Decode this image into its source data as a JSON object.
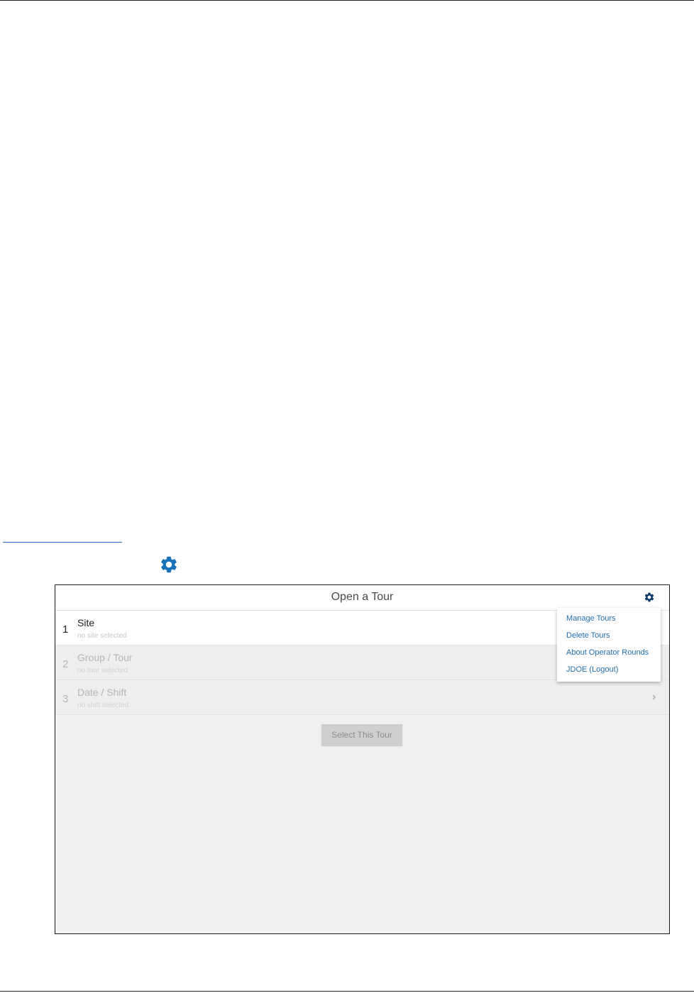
{
  "dialog": {
    "title": "Open a Tour",
    "steps": [
      {
        "number": "1",
        "title": "Site",
        "subtitle": "no site selected"
      },
      {
        "number": "2",
        "title": "Group / Tour",
        "subtitle": "no tour selected"
      },
      {
        "number": "3",
        "title": "Date / Shift",
        "subtitle": "no shift selected"
      }
    ],
    "chevron": "›",
    "select_button": "Select This Tour"
  },
  "menu": {
    "items": [
      "Manage Tours",
      "Delete Tours",
      "About Operator Rounds",
      "JDOE (Logout)"
    ]
  },
  "icons": {
    "inline_gear": "gear-icon",
    "toolbar_gear": "gear-icon"
  },
  "colors": {
    "accent_blue": "#1f6fb0",
    "link_blue": "#2b64c5",
    "toolbar_gear": "#0d3a66"
  }
}
